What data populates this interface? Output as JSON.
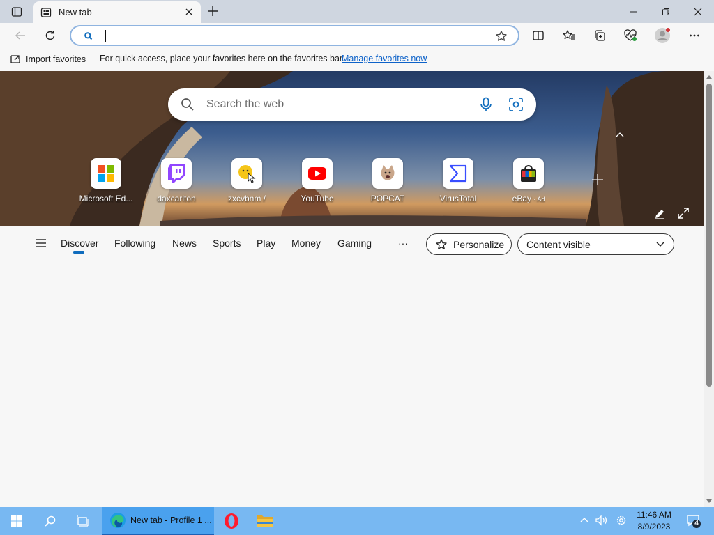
{
  "window": {
    "tab_title": "New tab"
  },
  "address_bar": {
    "value": ""
  },
  "favorites_bar": {
    "import_label": "Import favorites",
    "hint": "For quick access, place your favorites here on the favorites bar.",
    "manage_link": "Manage favorites now"
  },
  "search": {
    "placeholder": "Search the web"
  },
  "quick_links": [
    {
      "label": "Microsoft Ed...",
      "icon": "microsoft-icon"
    },
    {
      "label": "daxcarlton",
      "icon": "twitch-icon"
    },
    {
      "label": "zxcvbnm /",
      "icon": "emoji-icon"
    },
    {
      "label": "YouTube",
      "icon": "youtube-icon"
    },
    {
      "label": "POPCAT",
      "icon": "popcat-icon"
    },
    {
      "label": "VirusTotal",
      "icon": "virustotal-icon"
    },
    {
      "label": "eBay",
      "ad": "· Ad",
      "icon": "ebay-icon"
    }
  ],
  "feed_nav": {
    "items": [
      "Discover",
      "Following",
      "News",
      "Sports",
      "Play",
      "Money",
      "Gaming"
    ],
    "more": "···",
    "personalize": "Personalize",
    "content_select": "Content visible"
  },
  "taskbar": {
    "edge_label": "New tab - Profile 1 ...",
    "time": "11:46 AM",
    "date": "8/9/2023",
    "notification_count": "4"
  },
  "colors": {
    "accent": "#0f6cbd",
    "taskbar": "#78b8f2",
    "titlebar": "#cfd6e0"
  }
}
